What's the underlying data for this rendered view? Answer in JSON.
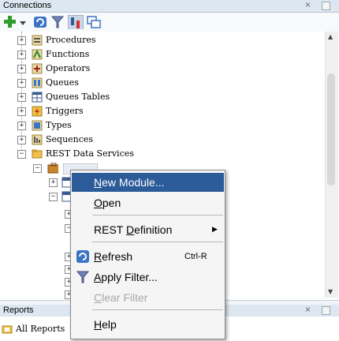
{
  "connections_panel": {
    "title": "Connections",
    "close_glyph": "×",
    "minimize_glyph": "−"
  },
  "toolbar": {
    "buttons": [
      "new-connection-icon",
      "dropdown-arrow-icon",
      "refresh-icon",
      "filter-icon",
      "schema-browser-icon",
      "manage-connections-icon"
    ]
  },
  "tree": {
    "items": [
      {
        "label": "Procedures",
        "icon": "procedure-icon",
        "expander": "+"
      },
      {
        "label": "Functions",
        "icon": "function-icon",
        "expander": "+"
      },
      {
        "label": "Operators",
        "icon": "operator-icon",
        "expander": "+"
      },
      {
        "label": "Queues",
        "icon": "queue-icon",
        "expander": "+"
      },
      {
        "label": "Queues Tables",
        "icon": "queue-table-icon",
        "expander": "+"
      },
      {
        "label": "Triggers",
        "icon": "trigger-icon",
        "expander": "+"
      },
      {
        "label": "Types",
        "icon": "type-icon",
        "expander": "+"
      },
      {
        "label": "Sequences",
        "icon": "sequence-icon",
        "expander": "+"
      },
      {
        "label": "REST Data Services",
        "icon": "folder-icon",
        "expander": "−"
      }
    ]
  },
  "context_menu": {
    "items": [
      {
        "label": "New Module...",
        "mnemonic": "N",
        "selected": true
      },
      {
        "label": "Open",
        "mnemonic": "O"
      },
      {
        "label": "REST Definition",
        "mnemonic": "D",
        "submenu": true
      },
      {
        "label": "Refresh",
        "mnemonic": "R",
        "shortcut": "Ctrl-R",
        "icon": "refresh-icon"
      },
      {
        "label": "Apply Filter...",
        "mnemonic": "A",
        "icon": "filter-icon"
      },
      {
        "label": "Clear Filter",
        "mnemonic": "C",
        "disabled": true
      },
      {
        "label": "Help",
        "mnemonic": "H"
      }
    ],
    "submenu_arrow": "▶"
  },
  "reports_panel": {
    "title": "Reports",
    "all_reports": "All Reports",
    "close_glyph": "×",
    "minimize_glyph": "−"
  },
  "colors": {
    "selection": "#2c5b99",
    "header": "#dde7f1"
  }
}
